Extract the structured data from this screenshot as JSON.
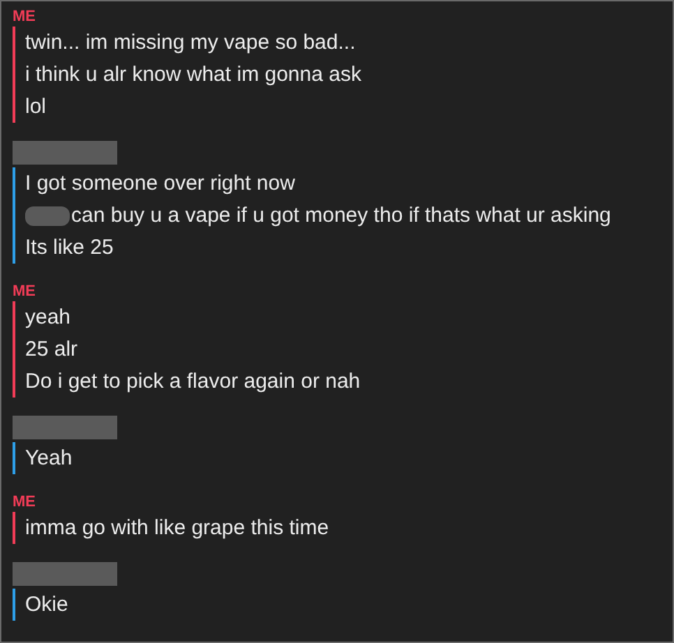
{
  "groups": [
    {
      "kind": "me",
      "sender": "ME",
      "lines": [
        {
          "text": "twin... im missing my vape so bad...",
          "redacted_prefix": false
        },
        {
          "text": "i think u alr know what im gonna ask",
          "redacted_prefix": false
        },
        {
          "text": "lol",
          "redacted_prefix": false
        }
      ]
    },
    {
      "kind": "other",
      "lines": [
        {
          "text": "I got someone over right now",
          "redacted_prefix": false
        },
        {
          "text": "can buy u a vape if u got money tho if thats what ur asking",
          "redacted_prefix": true
        },
        {
          "text": "Its like 25",
          "redacted_prefix": false
        }
      ]
    },
    {
      "kind": "me",
      "sender": "ME",
      "lines": [
        {
          "text": "yeah",
          "redacted_prefix": false
        },
        {
          "text": "25 alr",
          "redacted_prefix": false
        },
        {
          "text": "Do i get to pick a flavor again or nah",
          "redacted_prefix": false
        }
      ]
    },
    {
      "kind": "other",
      "lines": [
        {
          "text": "Yeah",
          "redacted_prefix": false
        }
      ]
    },
    {
      "kind": "me",
      "sender": "ME",
      "lines": [
        {
          "text": "imma go with like grape this time",
          "redacted_prefix": false
        }
      ]
    },
    {
      "kind": "other",
      "lines": [
        {
          "text": "Okie",
          "redacted_prefix": false
        }
      ]
    }
  ]
}
